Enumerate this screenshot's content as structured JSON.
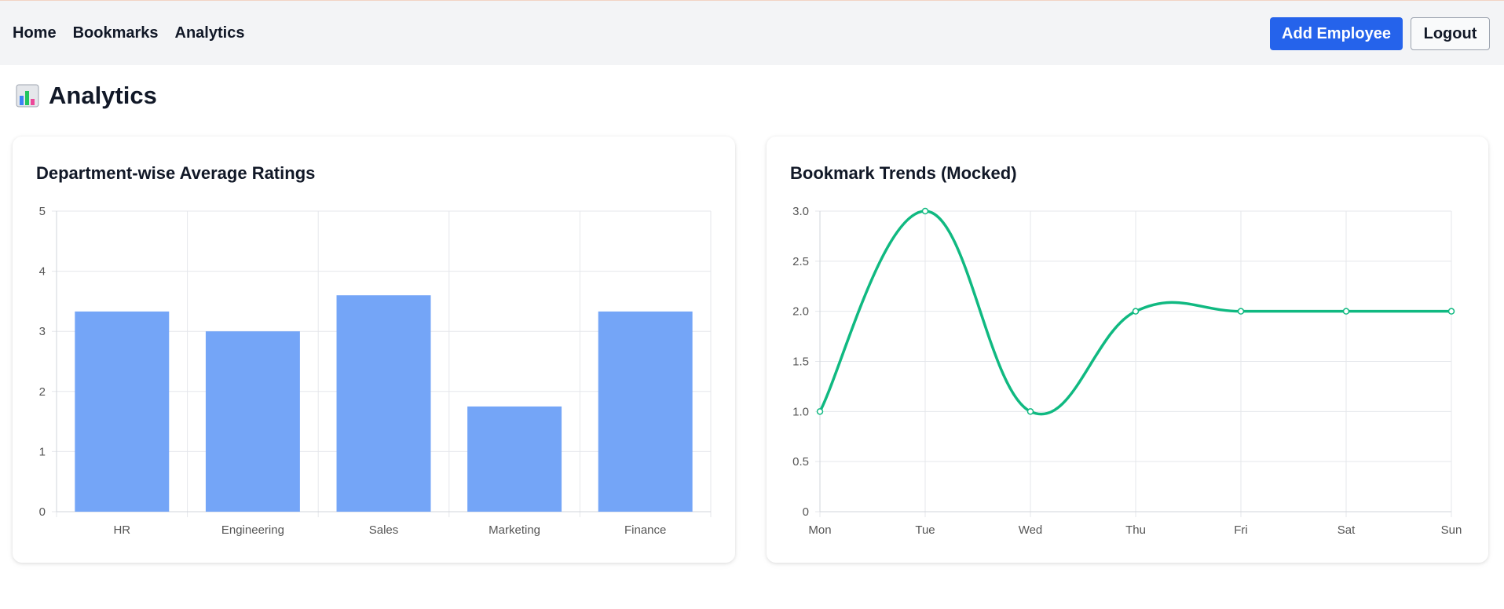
{
  "nav": {
    "items": [
      {
        "label": "Home"
      },
      {
        "label": "Bookmarks"
      },
      {
        "label": "Analytics"
      }
    ],
    "add_employee_label": "Add Employee",
    "logout_label": "Logout"
  },
  "page": {
    "title": "Analytics",
    "title_icon": "bar-chart-icon"
  },
  "colors": {
    "accent": "#2563eb",
    "bar": "#74a5f7",
    "line": "#10b981"
  },
  "chart_data": [
    {
      "type": "bar",
      "title": "Department-wise Average Ratings",
      "categories": [
        "HR",
        "Engineering",
        "Sales",
        "Marketing",
        "Finance"
      ],
      "values": [
        3.33,
        3.0,
        3.6,
        1.75,
        3.33
      ],
      "ylim": [
        0,
        5
      ],
      "yticks": [
        "0",
        "1",
        "2",
        "3",
        "4",
        "5"
      ],
      "grid": true
    },
    {
      "type": "line",
      "title": "Bookmark Trends (Mocked)",
      "x": [
        "Mon",
        "Tue",
        "Wed",
        "Thu",
        "Fri",
        "Sat",
        "Sun"
      ],
      "values": [
        1,
        3,
        1,
        2,
        2,
        2,
        2
      ],
      "ylim": [
        0,
        3
      ],
      "yticks": [
        "0",
        "0.5",
        "1.0",
        "1.5",
        "2.0",
        "2.5",
        "3.0"
      ],
      "grid": true
    }
  ]
}
